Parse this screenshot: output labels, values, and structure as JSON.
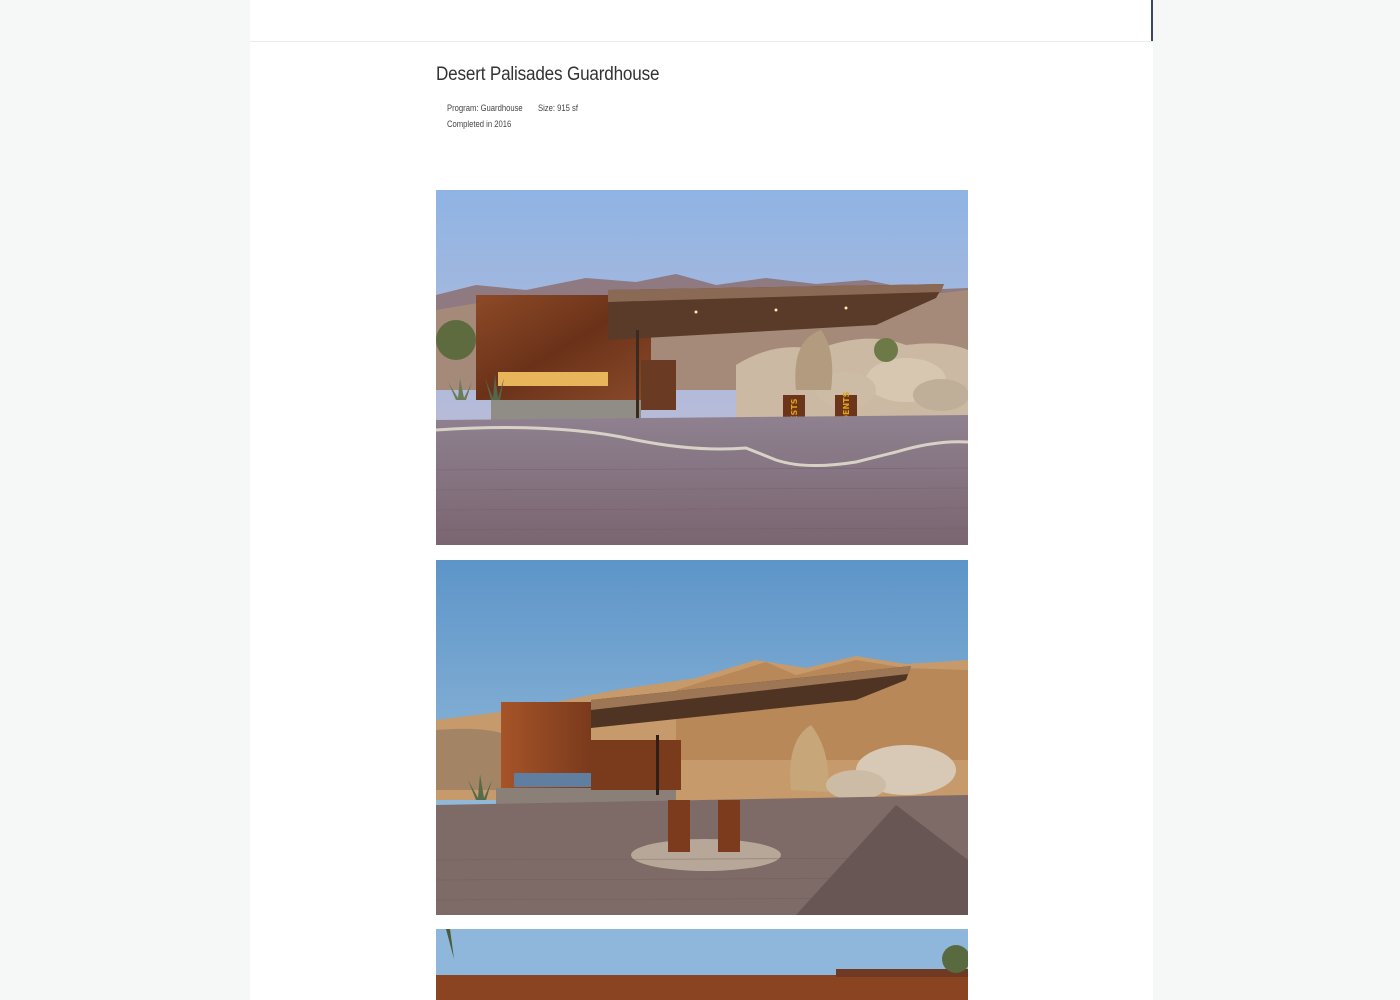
{
  "project": {
    "title": "Desert Palisades Guardhouse",
    "program": "Program: Guardhouse",
    "size": "Size: 915 sf",
    "completed": "Completed in 2016"
  },
  "photos": [
    {
      "sign_left": "GUESTS",
      "sign_right": "RESIDENTS"
    },
    {
      "sign_left": "",
      "sign_right": ""
    },
    {}
  ],
  "colors": {
    "page_background": "#f6f8f7",
    "panel_background": "#ffffff",
    "scroll_marker": "#3c4562",
    "title_text": "#333333",
    "corten_steel": "#8a4422",
    "sign_lettering": "#e0a21c"
  }
}
